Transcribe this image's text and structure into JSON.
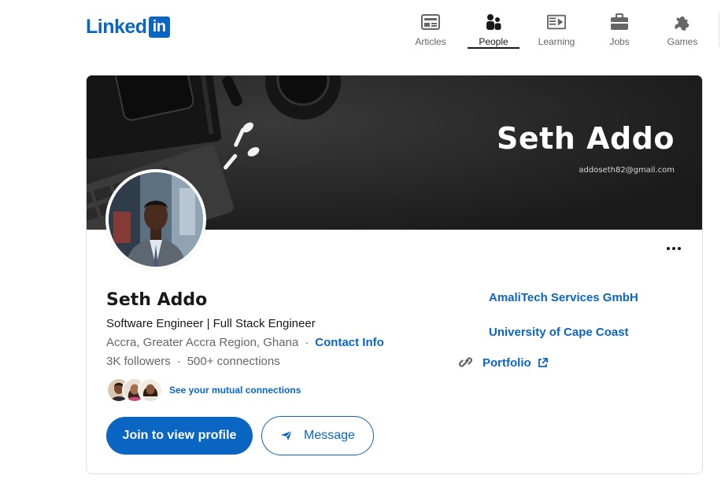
{
  "header": {
    "logo_text": "Linked",
    "logo_box_text": "in",
    "nav": [
      {
        "label": "Articles",
        "icon": "articles-icon",
        "active": false
      },
      {
        "label": "People",
        "icon": "people-icon",
        "active": true
      },
      {
        "label": "Learning",
        "icon": "learning-icon",
        "active": false
      },
      {
        "label": "Jobs",
        "icon": "jobs-icon",
        "active": false
      },
      {
        "label": "Games",
        "icon": "games-icon",
        "active": false
      }
    ]
  },
  "banner": {
    "title": "Seth Addo",
    "email": "addoseth82@gmail.com"
  },
  "profile": {
    "name": "Seth Addo",
    "headline": "Software Engineer | Full Stack Engineer",
    "location": "Accra, Greater Accra Region, Ghana",
    "separator": "·",
    "contact_info": "Contact Info",
    "followers": "3K followers",
    "connections": "500+ connections",
    "mutual_connections": "See your mutual connections"
  },
  "experience": {
    "company": "AmaliTech Services GmbH",
    "school": "University of Cape Coast",
    "portfolio": "Portfolio"
  },
  "actions": {
    "join_label": "Join to view profile",
    "message_label": "Message"
  },
  "colors": {
    "brand": "#0a66c2",
    "text": "#191919",
    "muted": "#666666"
  }
}
